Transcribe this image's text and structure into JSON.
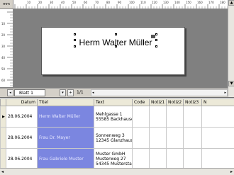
{
  "ruler": {
    "corner_label": "mm",
    "h_marks": [
      "10",
      "20",
      "30",
      "40",
      "50",
      "60",
      "70",
      "80",
      "90",
      "100",
      "110",
      "120",
      "130",
      "140",
      "150",
      "160",
      "170",
      "180"
    ],
    "v_marks": [
      "10",
      "20",
      "30",
      "40",
      "50",
      "60"
    ]
  },
  "designer": {
    "textbox_text": "Herm Walter Müller"
  },
  "bottombar": {
    "sheet_tab": "Blatt 1",
    "page_info": "1/1"
  },
  "grid": {
    "headers": [
      "",
      "Datum",
      "Titel",
      "Text",
      "Code",
      "Notiz1",
      "Notiz2",
      "Notiz3",
      "N"
    ],
    "rows": [
      {
        "indicator": "▶",
        "datum": "28.06.2004",
        "titel": "Herm Walter Müller",
        "text": [
          "Mehlgasse 1",
          "55585 Backhausen"
        ],
        "code": "",
        "notiz1": "",
        "notiz2": "",
        "notiz3": ""
      },
      {
        "indicator": "",
        "datum": "28.06.2004",
        "titel": "Frau Dr. Mayer",
        "text": [
          "Sonnenweg 3",
          "12345 Glanzhausen"
        ],
        "code": "",
        "notiz1": "",
        "notiz2": "",
        "notiz3": ""
      },
      {
        "indicator": "",
        "datum": "28.06.2004",
        "titel": "Frau Gabriele Muster",
        "text": [
          "Muster GmbH",
          "Musterweg 27",
          "54345 Musterstadt"
        ],
        "code": "",
        "notiz1": "",
        "notiz2": "",
        "notiz3": ""
      }
    ]
  }
}
